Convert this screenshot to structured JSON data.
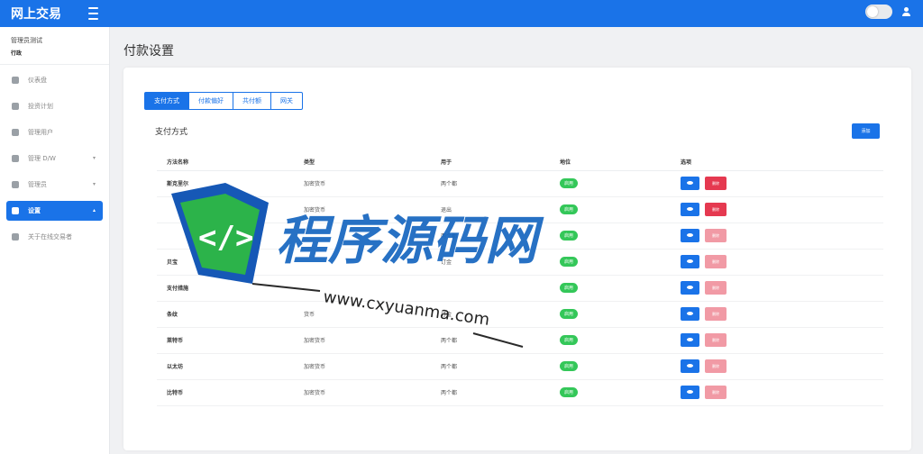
{
  "header": {
    "brand": "网上交易"
  },
  "sidebar": {
    "profile_name": "管理员测试",
    "profile_role": "行政",
    "items": [
      {
        "label": "仪表盘",
        "icon": "home-icon",
        "has_chevron": false,
        "active": false
      },
      {
        "label": "投资计划",
        "icon": "chart-icon",
        "has_chevron": false,
        "active": false
      },
      {
        "label": "管理用户",
        "icon": "user-circle-icon",
        "has_chevron": false,
        "active": false
      },
      {
        "label": "管理 D/W",
        "icon": "credit-card-icon",
        "has_chevron": true,
        "active": false
      },
      {
        "label": "管理员",
        "icon": "user-icon",
        "has_chevron": true,
        "active": false
      },
      {
        "label": "设置",
        "icon": "gear-icon",
        "has_chevron": true,
        "active": true
      },
      {
        "label": "关于在线交易者",
        "icon": "info-icon",
        "has_chevron": false,
        "active": false
      }
    ]
  },
  "page": {
    "title": "付款设置"
  },
  "tabs": [
    {
      "label": "支付方式",
      "active": true
    },
    {
      "label": "付款偏好",
      "active": false
    },
    {
      "label": "共付额",
      "active": false
    },
    {
      "label": "网关",
      "active": false
    }
  ],
  "section": {
    "title": "支付方式",
    "add_label": "添加"
  },
  "table": {
    "headers": [
      "方法名称",
      "类型",
      "用于",
      "地位",
      "选项"
    ],
    "rows": [
      {
        "name": "斯克里尔",
        "type": "加密货币",
        "used_for": "两个都",
        "status": "启用",
        "delete_label": "删除",
        "strong": true
      },
      {
        "name": "",
        "type": "加密货币",
        "used_for": "退出",
        "status": "启用",
        "delete_label": "删除",
        "strong": true
      },
      {
        "name": "",
        "type": "",
        "used_for": "两个都",
        "status": "启用",
        "delete_label": "删除",
        "strong": false
      },
      {
        "name": "贝宝",
        "type": "",
        "used_for": "订金",
        "status": "启用",
        "delete_label": "删除",
        "strong": false
      },
      {
        "name": "支付措施",
        "type": "",
        "used_for": "",
        "status": "启用",
        "delete_label": "删除",
        "strong": false
      },
      {
        "name": "条纹",
        "type": "货币",
        "used_for": "订金",
        "status": "启用",
        "delete_label": "删除",
        "strong": false
      },
      {
        "name": "莱特币",
        "type": "加密货币",
        "used_for": "两个都",
        "status": "启用",
        "delete_label": "删除",
        "strong": false
      },
      {
        "name": "以太坊",
        "type": "加密货币",
        "used_for": "两个都",
        "status": "启用",
        "delete_label": "删除",
        "strong": false
      },
      {
        "name": "比特币",
        "type": "加密货币",
        "used_for": "两个都",
        "status": "启用",
        "delete_label": "删除",
        "strong": false
      }
    ]
  },
  "watermark": {
    "line1": "程序源码网",
    "line2": "www.cxyuanma.com"
  },
  "colors": {
    "primary": "#1a73e8",
    "success": "#34c759",
    "danger": "#e53950",
    "danger_light": "#f19aa5"
  }
}
